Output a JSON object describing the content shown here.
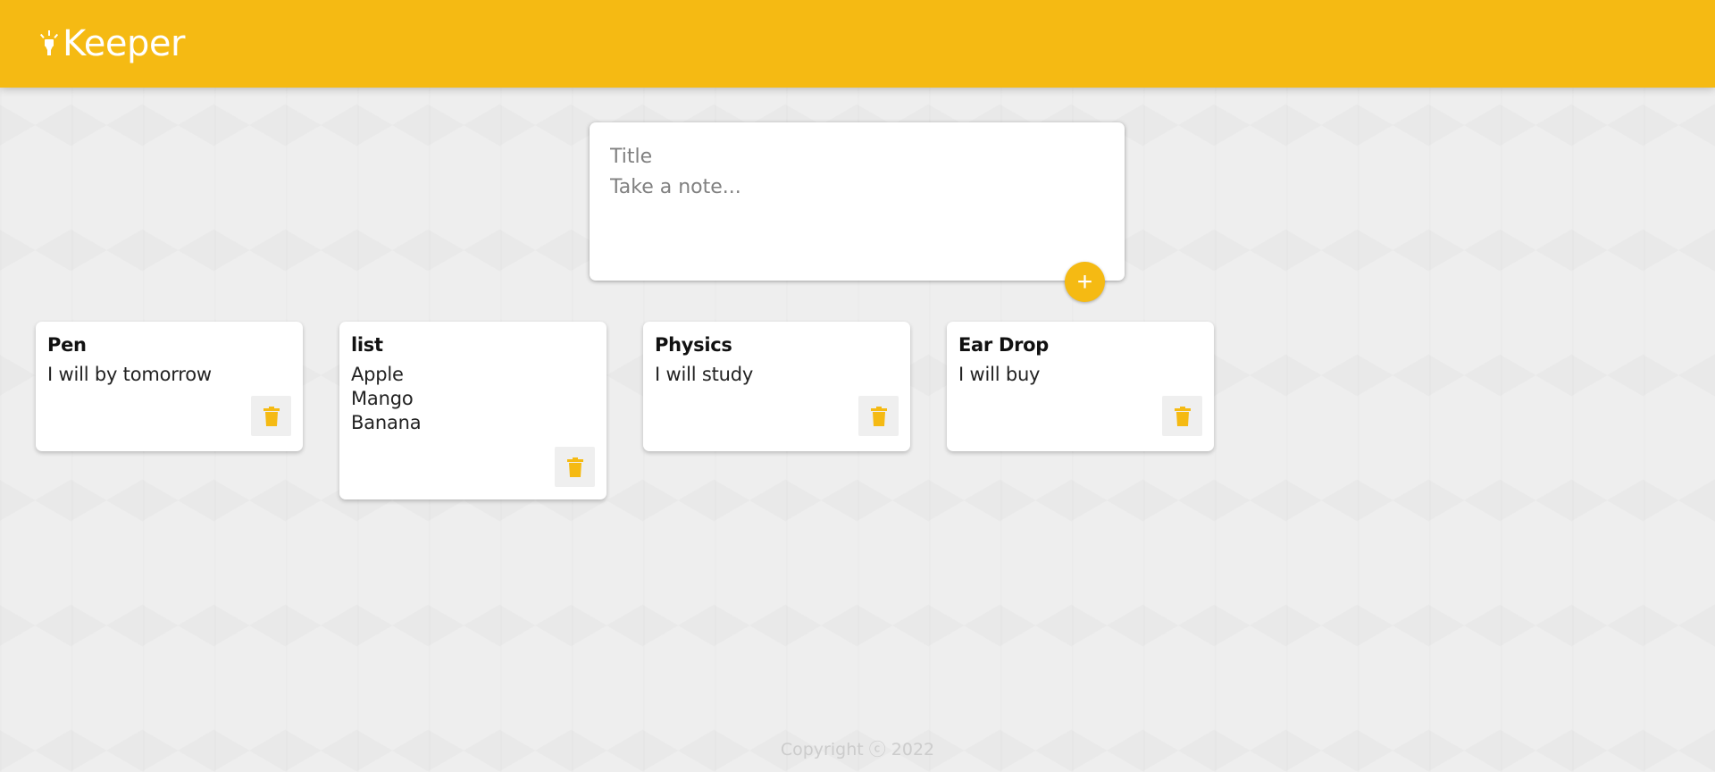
{
  "header": {
    "app_name": "Keeper",
    "logo_icon": "highlight-lamp-icon",
    "accent_color": "#f5ba13"
  },
  "create_area": {
    "title_placeholder": "Title",
    "content_placeholder": "Take a note...",
    "add_icon": "plus-icon",
    "add_label": "+"
  },
  "notes": [
    {
      "title": "Pen",
      "content": "I will by tomorrow",
      "delete_icon": "trash-icon"
    },
    {
      "title": "list",
      "content": "Apple\nMango\nBanana",
      "delete_icon": "trash-icon"
    },
    {
      "title": "Physics",
      "content": "I will study",
      "delete_icon": "trash-icon"
    },
    {
      "title": "Ear Drop",
      "content": "I will buy",
      "delete_icon": "trash-icon"
    }
  ],
  "footer": {
    "text": "Copyright ⓒ 2022"
  }
}
